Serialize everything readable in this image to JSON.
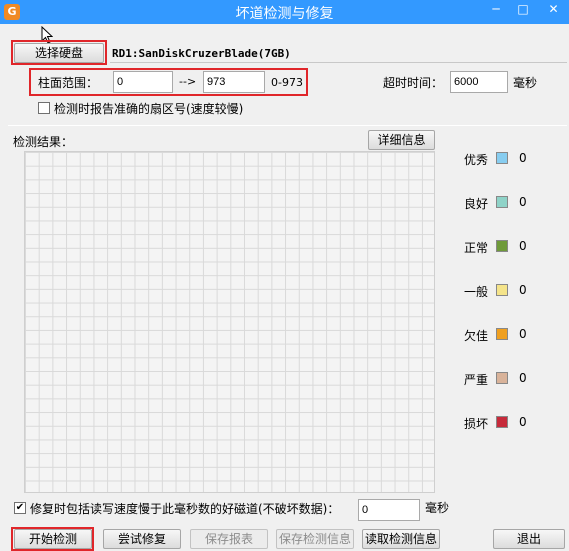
{
  "window": {
    "title": "坏道检测与修复",
    "minimize": "─",
    "maximize": "□",
    "close": "✕"
  },
  "disk": {
    "select_button": "选择硬盘",
    "name": "RD1:SanDiskCruzerBlade(7GB)"
  },
  "range": {
    "label": "柱面范围：",
    "from": "0",
    "arrow": "-->",
    "to": "973",
    "hint": "0-973"
  },
  "timeout": {
    "label": "超时时间：",
    "value": "6000",
    "unit": "毫秒"
  },
  "option_report_sector": {
    "checked": false,
    "label": "检测时报告准确的扇区号(速度较慢)"
  },
  "results": {
    "label": "检测结果：",
    "details_button": "详细信息"
  },
  "legend": [
    {
      "label": "优秀",
      "color": "#87cdf0",
      "count": "0"
    },
    {
      "label": "良好",
      "color": "#8fd3c8",
      "count": "0"
    },
    {
      "label": "正常",
      "color": "#6f9a3a",
      "count": "0"
    },
    {
      "label": "一般",
      "color": "#f5e48a",
      "count": "0"
    },
    {
      "label": "欠佳",
      "color": "#f0a020",
      "count": "0"
    },
    {
      "label": "严重",
      "color": "#d9b39a",
      "count": "0"
    },
    {
      "label": "损坏",
      "color": "#c62a3a",
      "count": "0"
    }
  ],
  "option_slow_track": {
    "checked": true,
    "label": "修复时包括读写速度慢于此毫秒数的好磁道(不破坏数据)：",
    "value": "0",
    "unit": "毫秒"
  },
  "buttons": {
    "start": "开始检测",
    "try_repair": "尝试修复",
    "save_report": "保存报表",
    "save_info": "保存检测信息",
    "read_info": "读取检测信息",
    "exit": "退出"
  }
}
